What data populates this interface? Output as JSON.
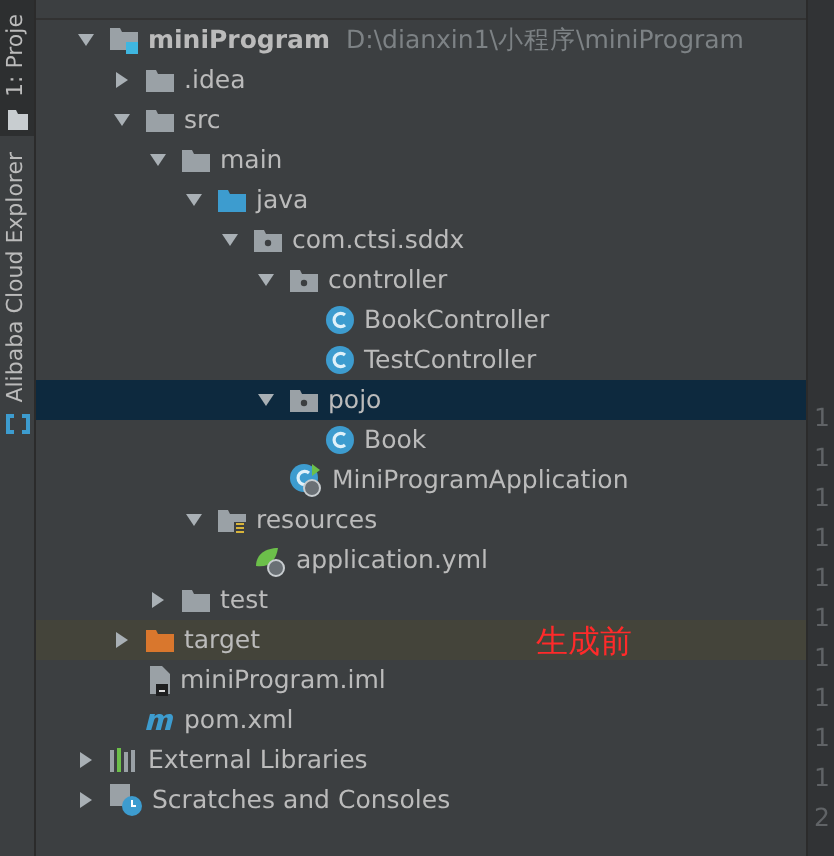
{
  "tool_strip": [
    {
      "label": "1: Proje",
      "selected": true
    },
    {
      "label": "Alibaba Cloud Explorer",
      "selected": false
    }
  ],
  "tree": [
    {
      "label": "miniProgram",
      "path": "D:\\dianxin1\\小程序\\miniProgram",
      "kind": "module",
      "expanded": true,
      "selected": false,
      "children": [
        {
          "label": ".idea",
          "kind": "folder",
          "expanded": false,
          "selected": false
        },
        {
          "label": "src",
          "kind": "folder",
          "expanded": true,
          "selected": false,
          "children": [
            {
              "label": "main",
              "kind": "folder",
              "expanded": true,
              "selected": false,
              "children": [
                {
                  "label": "java",
                  "kind": "source-folder",
                  "expanded": true,
                  "selected": false,
                  "children": [
                    {
                      "label": "com.ctsi.sddx",
                      "kind": "package",
                      "expanded": true,
                      "selected": false,
                      "children": [
                        {
                          "label": "controller",
                          "kind": "package",
                          "expanded": true,
                          "selected": false,
                          "children": [
                            {
                              "label": "BookController",
                              "kind": "class",
                              "selected": false
                            },
                            {
                              "label": "TestController",
                              "kind": "class",
                              "selected": false
                            }
                          ]
                        },
                        {
                          "label": "pojo",
                          "kind": "package",
                          "expanded": true,
                          "selected": true,
                          "children": [
                            {
                              "label": "Book",
                              "kind": "class",
                              "selected": false
                            }
                          ]
                        },
                        {
                          "label": "MiniProgramApplication",
                          "kind": "app",
                          "selected": false
                        }
                      ]
                    }
                  ]
                },
                {
                  "label": "resources",
                  "kind": "resources",
                  "expanded": true,
                  "selected": false,
                  "children": [
                    {
                      "label": "application.yml",
                      "kind": "yml",
                      "selected": false
                    }
                  ]
                }
              ]
            },
            {
              "label": "test",
              "kind": "folder",
              "expanded": false,
              "selected": false
            }
          ]
        },
        {
          "label": "target",
          "kind": "excluded-folder",
          "expanded": false,
          "selected": false
        },
        {
          "label": "miniProgram.iml",
          "kind": "iml",
          "selected": false
        },
        {
          "label": "pom.xml",
          "kind": "maven",
          "selected": false
        }
      ]
    },
    {
      "label": "External Libraries",
      "kind": "libraries",
      "expanded": false,
      "selected": false
    },
    {
      "label": "Scratches and Consoles",
      "kind": "scratches",
      "expanded": false,
      "selected": false
    }
  ],
  "annotation": "生成前",
  "gutter_line_numbers": [
    "1",
    "1",
    "1",
    "1",
    "1",
    "1",
    "1",
    "1",
    "1",
    "1",
    "2"
  ]
}
